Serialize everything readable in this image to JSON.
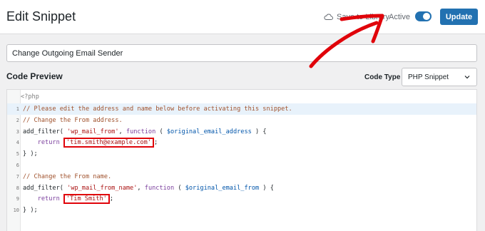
{
  "header": {
    "title": "Edit Snippet",
    "save_label": "Save to Library",
    "active_label": "Active",
    "active_state": true,
    "update_label": "Update"
  },
  "snippet": {
    "name_value": "Change Outgoing Email Sender"
  },
  "code_preview": {
    "title": "Code Preview",
    "code_type_label": "Code Type",
    "code_type_value": "PHP Snippet",
    "php_open": "<?php",
    "lines": [
      {
        "num": "1",
        "text": "// Please edit the address and name below before activating this snippet."
      },
      {
        "num": "2",
        "text": "// Change the From address."
      },
      {
        "num": "3",
        "text": "add_filter( 'wp_mail_from', function ( $original_email_address ) {"
      },
      {
        "num": "4",
        "pre": "    return ",
        "boxed": "'tim.smith@example.com'",
        "post": ";"
      },
      {
        "num": "5",
        "text": "} );"
      },
      {
        "num": "6",
        "text": ""
      },
      {
        "num": "7",
        "text": "// Change the From name."
      },
      {
        "num": "8",
        "text": "add_filter( 'wp_mail_from_name', function ( $original_email_from ) {"
      },
      {
        "num": "9",
        "pre": "    return ",
        "boxed": "'Tim Smith'",
        "post": ";"
      },
      {
        "num": "10",
        "text": "} );"
      }
    ]
  },
  "colors": {
    "accent": "#2271b1",
    "highlight_box": "#e0030a",
    "arrow": "#e0030a"
  },
  "icons": {
    "save": "cloud-icon",
    "dropdown": "chevron-down-icon"
  }
}
